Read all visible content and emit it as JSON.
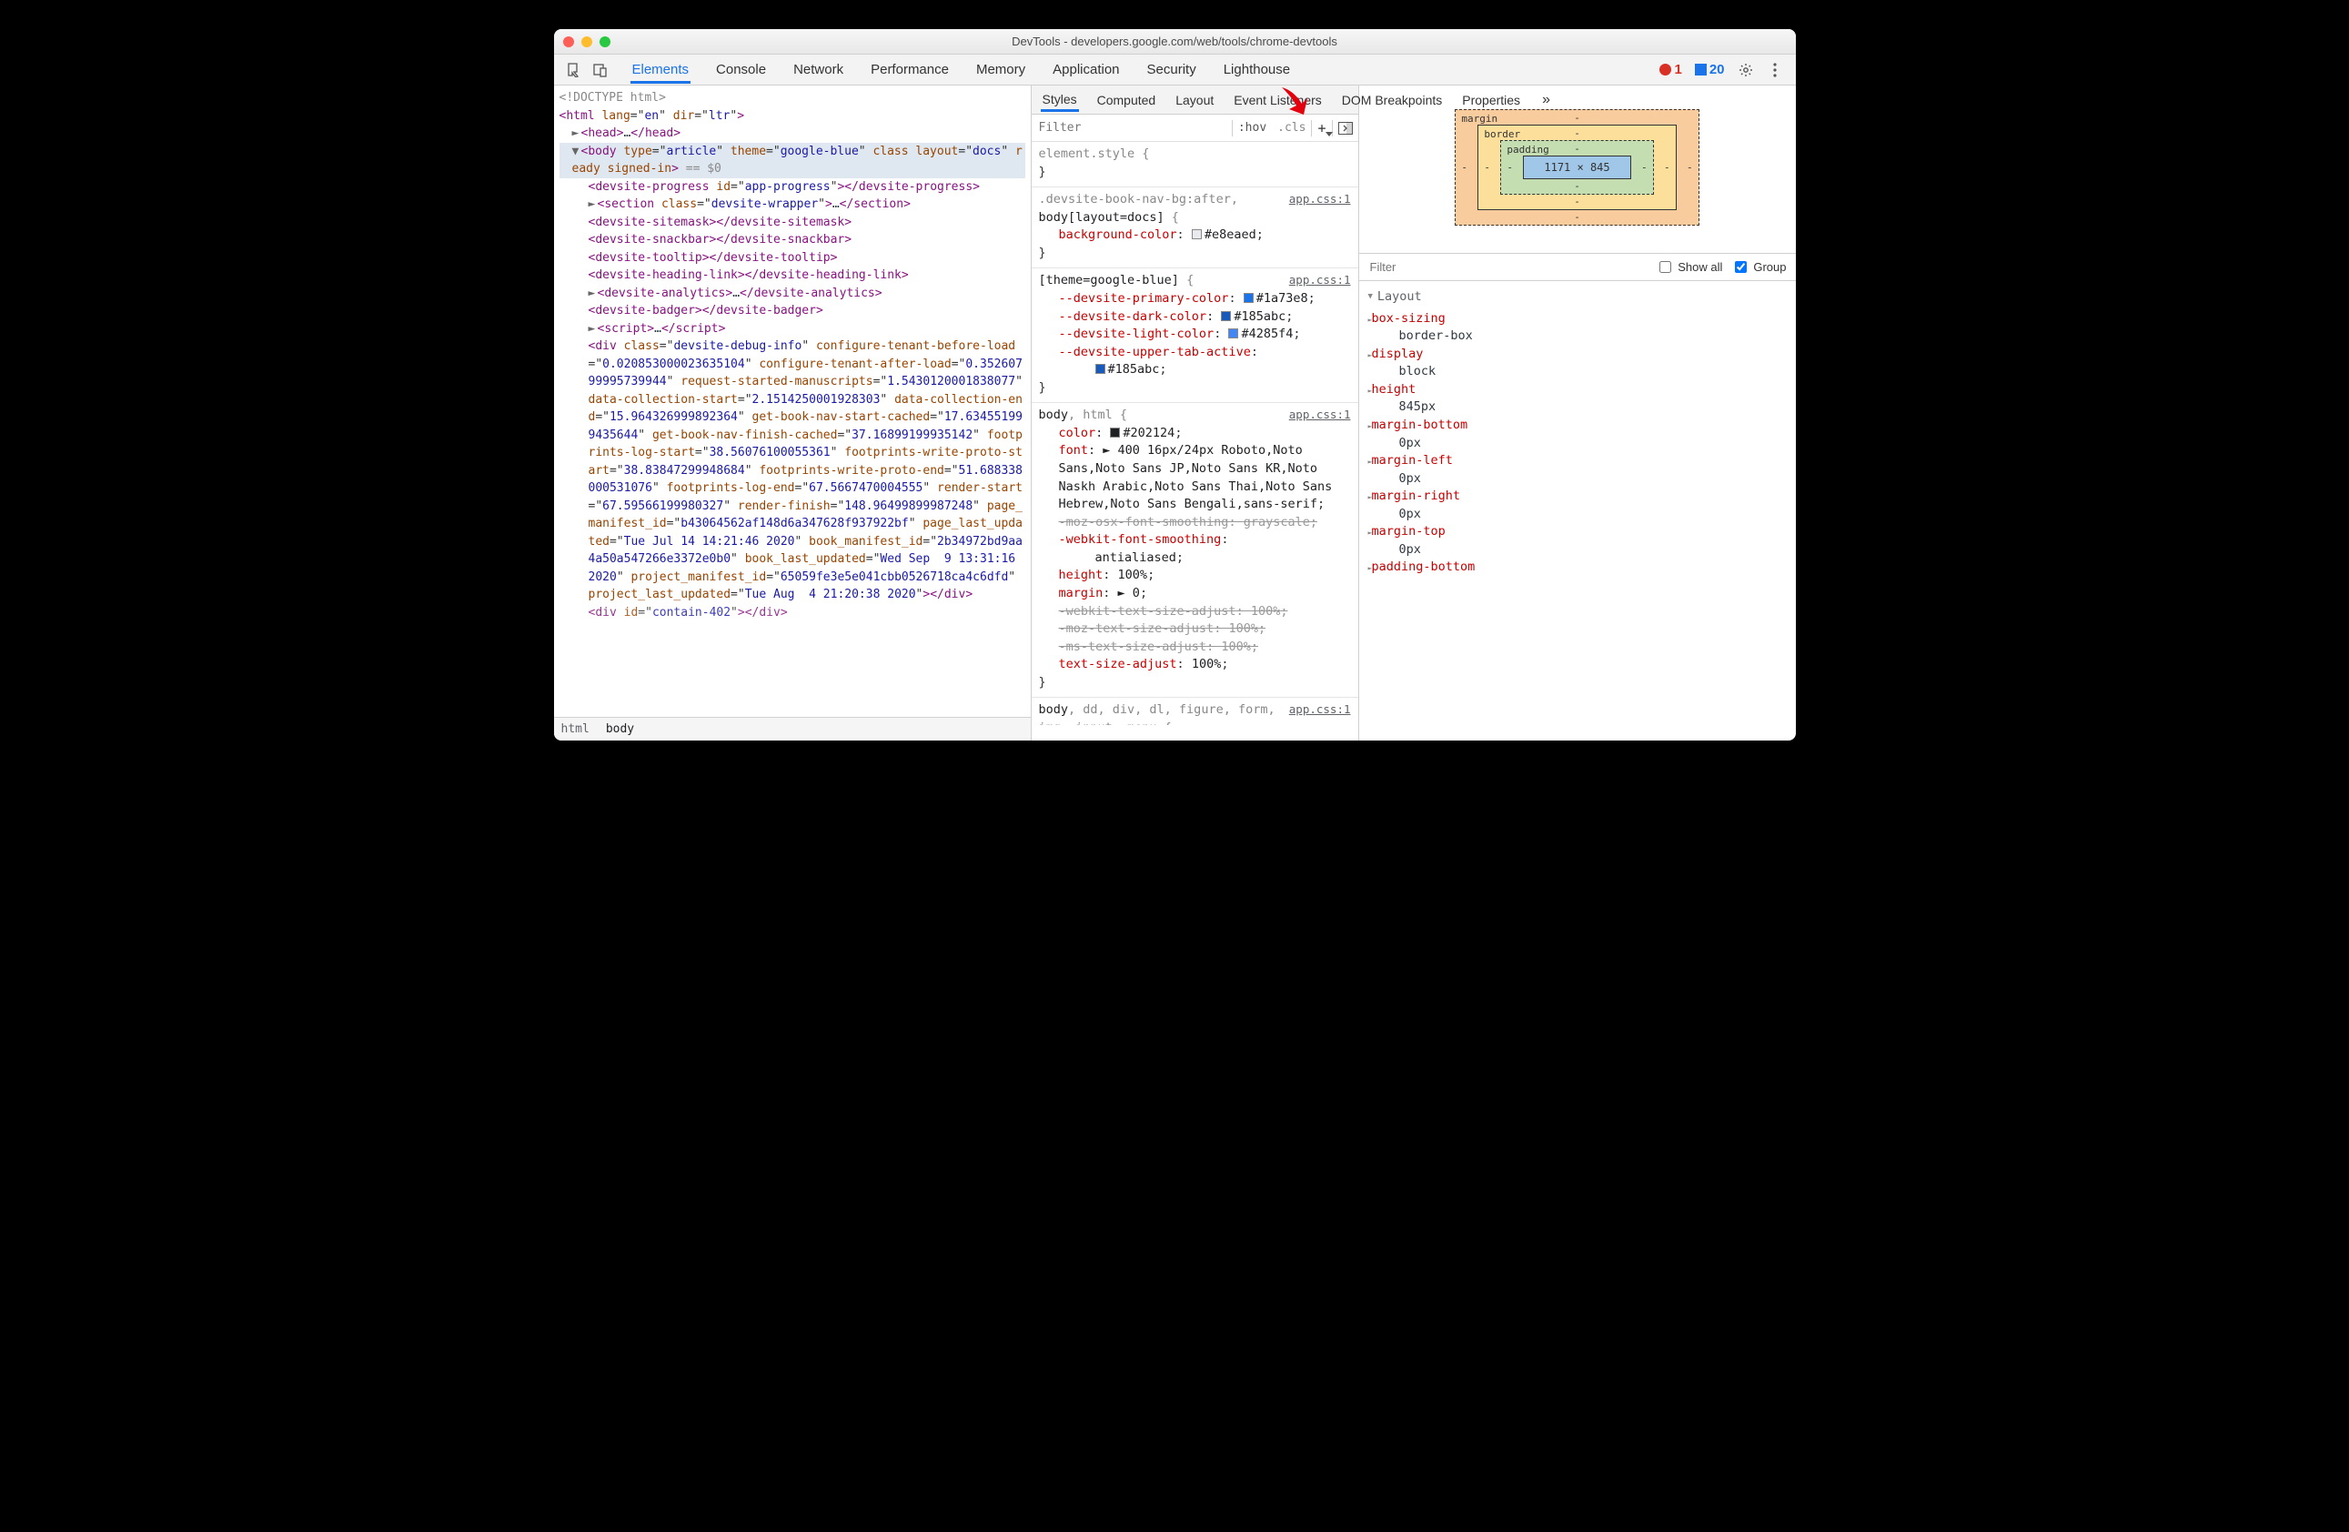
{
  "window": {
    "title": "DevTools - developers.google.com/web/tools/chrome-devtools"
  },
  "mainTabs": [
    "Elements",
    "Console",
    "Network",
    "Performance",
    "Memory",
    "Application",
    "Security",
    "Lighthouse"
  ],
  "mainActive": "Elements",
  "errors": "1",
  "messages": "20",
  "crumbs": [
    "html",
    "body"
  ],
  "crumbActive": "body",
  "subTabs": [
    "Styles",
    "Computed",
    "Layout",
    "Event Listeners",
    "DOM Breakpoints",
    "Properties"
  ],
  "subActive": "Styles",
  "stylesToolbar": {
    "filterPlaceholder": "Filter",
    "hov": ":hov",
    "cls": ".cls"
  },
  "compFilter": {
    "placeholder": "Filter",
    "showAll": "Show all",
    "group": "Group"
  },
  "boxModel": {
    "marginLabel": "margin",
    "borderLabel": "border",
    "paddingLabel": "padding",
    "content": "1171 × 845",
    "dash": "-"
  },
  "computed": {
    "section": "Layout",
    "items": [
      {
        "k": "box-sizing",
        "v": "border-box"
      },
      {
        "k": "display",
        "v": "block"
      },
      {
        "k": "height",
        "v": "845px"
      },
      {
        "k": "margin-bottom",
        "v": "0px"
      },
      {
        "k": "margin-left",
        "v": "0px"
      },
      {
        "k": "margin-right",
        "v": "0px"
      },
      {
        "k": "margin-top",
        "v": "0px"
      },
      {
        "k": "padding-bottom",
        "v": ""
      }
    ]
  },
  "rules": [
    {
      "selector": "element.style {",
      "src": "",
      "decls": [],
      "close": "}"
    },
    {
      "selector": ".devsite-book-nav-bg:after,\n<b>body[layout=docs]</b> {",
      "src": "app.css:1",
      "decls": [
        {
          "p": "background-color",
          "v": "#e8eaed",
          "sw": "#e8eaed"
        }
      ],
      "close": "}"
    },
    {
      "selector": "<b>[theme=google-blue]</b> {",
      "src": "app.css:1",
      "decls": [
        {
          "p": "--devsite-primary-color",
          "v": "#1a73e8",
          "sw": "#1a73e8"
        },
        {
          "p": "--devsite-dark-color",
          "v": "#185abc",
          "sw": "#185abc"
        },
        {
          "p": "--devsite-light-color",
          "v": "#4285f4",
          "sw": "#4285f4"
        },
        {
          "p": "--devsite-upper-tab-active",
          "v": "#185abc",
          "sw": "#185abc",
          "wrap": true
        }
      ],
      "close": "}"
    },
    {
      "selector": "<b>body</b>, html {",
      "src": "app.css:1",
      "decls": [
        {
          "p": "color",
          "v": "#202124",
          "sw": "#202124"
        },
        {
          "p": "font",
          "v": "► 400 16px/24px Roboto,Noto Sans,Noto Sans JP,Noto Sans KR,Noto Naskh Arabic,Noto Sans Thai,Noto Sans Hebrew,Noto Sans Bengali,sans-serif"
        },
        {
          "p": "-moz-osx-font-smoothing",
          "v": "grayscale",
          "strike": true
        },
        {
          "p": "-webkit-font-smoothing",
          "v": "antialiased",
          "wrap": true
        },
        {
          "p": "height",
          "v": "100%"
        },
        {
          "p": "margin",
          "v": "► 0"
        },
        {
          "p": "-webkit-text-size-adjust",
          "v": "100%",
          "strike": true
        },
        {
          "p": "-moz-text-size-adjust",
          "v": "100%",
          "strike": true
        },
        {
          "p": "-ms-text-size-adjust",
          "v": "100%",
          "strike": true
        },
        {
          "p": "text-size-adjust",
          "v": "100%"
        }
      ],
      "close": "}"
    },
    {
      "selector": "<b>body</b>, dd, div, dl, figure, form, img, input, menu {",
      "src": "app.css:1",
      "decls": [],
      "close": "",
      "cut": true
    }
  ],
  "dom": [
    {
      "ind": 0,
      "html": "<span class='grey'>&lt;!DOCTYPE html&gt;</span>"
    },
    {
      "ind": 0,
      "html": "<span class='tag'>&lt;html</span> <span class='attr'>lang</span>=\"<span class='val'>en</span>\" <span class='attr'>dir</span>=\"<span class='val'>ltr</span>\"<span class='tag'>&gt;</span>"
    },
    {
      "ind": 1,
      "html": "<span class='tri'>►</span><span class='tag'>&lt;head&gt;</span><span class='txt'>…</span><span class='tag'>&lt;/head&gt;</span>"
    },
    {
      "ind": 1,
      "sel": true,
      "html": "<span class='tri'>▼</span><span class='tag'>&lt;body</span> <span class='attr'>type</span>=\"<span class='val'>article</span>\" <span class='attr'>theme</span>=\"<span class='val'>google-blue</span>\" <span class='attr'>class</span> <span class='attr'>layout</span>=\"<span class='val'>docs</span>\" <span class='attr'>ready</span> <span class='attr'>signed-in</span><span class='tag'>&gt;</span> <span class='grey'>== $0</span>"
    },
    {
      "ind": 2,
      "html": "<span class='tag'>&lt;devsite-progress</span> <span class='attr'>id</span>=\"<span class='val'>app-progress</span>\"<span class='tag'>&gt;&lt;/devsite-progress&gt;</span>"
    },
    {
      "ind": 2,
      "html": "<span class='tri'>►</span><span class='tag'>&lt;section</span> <span class='attr'>class</span>=\"<span class='val'>devsite-wrapper</span>\"<span class='tag'>&gt;</span><span class='txt'>…</span><span class='tag'>&lt;/section&gt;</span>"
    },
    {
      "ind": 2,
      "html": "<span class='tag'>&lt;devsite-sitemask&gt;&lt;/devsite-sitemask&gt;</span>"
    },
    {
      "ind": 2,
      "html": "<span class='tag'>&lt;devsite-snackbar&gt;&lt;/devsite-snackbar&gt;</span>"
    },
    {
      "ind": 2,
      "html": "<span class='tag'>&lt;devsite-tooltip&gt;&lt;/devsite-tooltip&gt;</span>"
    },
    {
      "ind": 2,
      "html": "<span class='tag'>&lt;devsite-heading-link&gt;&lt;/devsite-heading-link&gt;</span>"
    },
    {
      "ind": 2,
      "html": "<span class='tri'>►</span><span class='tag'>&lt;devsite-analytics&gt;</span><span class='txt'>…</span><span class='tag'>&lt;/devsite-analytics&gt;</span>"
    },
    {
      "ind": 2,
      "html": "<span class='tag'>&lt;devsite-badger&gt;&lt;/devsite-badger&gt;</span>"
    },
    {
      "ind": 2,
      "html": "<span class='tri'>►</span><span class='tag'>&lt;script&gt;</span><span class='txt'>…</span><span class='tag'>&lt;/script&gt;</span>"
    },
    {
      "ind": 2,
      "html": "<span class='tag'>&lt;div</span> <span class='attr'>class</span>=\"<span class='val'>devsite-debug-info</span>\" <span class='attr'>configure-tenant-before-load</span>=\"<span class='val'>0.020853000023635104</span>\" <span class='attr'>configure-tenant-after-load</span>=\"<span class='val'>0.35260799995739944</span>\" <span class='attr'>request-started-manuscripts</span>=\"<span class='val'>1.5430120001838077</span>\" <span class='attr'>data-collection-start</span>=\"<span class='val'>2.1514250001928303</span>\" <span class='attr'>data-collection-end</span>=\"<span class='val'>15.964326999892364</span>\" <span class='attr'>get-book-nav-start-cached</span>=\"<span class='val'>17.634551999435644</span>\" <span class='attr'>get-book-nav-finish-cached</span>=\"<span class='val'>37.16899199935142</span>\" <span class='attr'>footprints-log-start</span>=\"<span class='val'>38.56076100055361</span>\" <span class='attr'>footprints-write-proto-start</span>=\"<span class='val'>38.83847299948684</span>\" <span class='attr'>footprints-write-proto-end</span>=\"<span class='val'>51.688338000531076</span>\" <span class='attr'>footprints-log-end</span>=\"<span class='val'>67.5667470004555</span>\" <span class='attr'>render-start</span>=\"<span class='val'>67.59566199980327</span>\" <span class='attr'>render-finish</span>=\"<span class='val'>148.96499899987248</span>\" <span class='attr'>page_manifest_id</span>=\"<span class='val'>b43064562af148d6a347628f937922bf</span>\" <span class='attr'>page_last_updated</span>=\"<span class='val'>Tue Jul 14 14:21:46 2020</span>\" <span class='attr'>book_manifest_id</span>=\"<span class='val'>2b34972bd9aa4a50a547266e3372e0b0</span>\" <span class='attr'>book_last_updated</span>=\"<span class='val'>Wed Sep  9 13:31:16 2020</span>\" <span class='attr'>project_manifest_id</span>=\"<span class='val'>65059fe3e5e041cbb0526718ca4c6dfd</span>\" <span class='attr'>project_last_updated</span>=\"<span class='val'>Tue Aug  4 21:20:38 2020</span>\"<span class='tag'>&gt;&lt;/div&gt;</span>"
    },
    {
      "ind": 2,
      "html": "<span class='tag'>&lt;div</span> <span class='attr'>id</span>=\"<span class='val'>contain-402</span>\"<span class='tag'>&gt;&lt;/div&gt;</span>",
      "cut": true
    }
  ]
}
